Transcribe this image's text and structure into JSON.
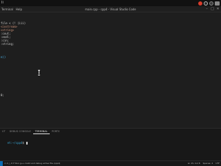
{
  "os_bar": {
    "left_label": "Ii"
  },
  "titlebar": {
    "menu": [
      "Terminal",
      "Help"
    ],
    "title": "main.cpp - cpp4 - Visual Studio Code",
    "controls": [
      "–",
      "□",
      "✕"
    ]
  },
  "editor": {
    "lines": [
      {
        "text": "file < (! (iii)",
        "color": "#d4d4d4"
      },
      {
        "text": "<iostream>",
        "color": "#ce9178"
      },
      {
        "text": "<string>",
        "color": "#ce9178"
      },
      {
        "text": ":cout;",
        "color": "#d4d4d4"
      },
      {
        "text": ":endl;",
        "color": "#d4d4d4"
      },
      {
        "text": ":cin;",
        "color": "#d4d4d4"
      },
      {
        "text": ":string;",
        "color": "#d4d4d4"
      },
      {
        "text": "n()",
        "color": "#4fc1ff"
      },
      {
        "text": "",
        "color": "#d4d4d4"
      },
      {
        "text": "0;",
        "color": "#d4d4d4"
      }
    ]
  },
  "panel": {
    "tabs": [
      {
        "label": "UT",
        "active": false
      },
      {
        "label": "DEBUG CONSOLE",
        "active": false
      },
      {
        "label": "TERMINAL",
        "active": true
      },
      {
        "label": "PORTS",
        "active": false
      }
    ],
    "terminal": {
      "path": "et:~/cpp4",
      "prompt": "$"
    }
  },
  "statusbar": {
    "left": "⚠ 0 △ 0  ⟳ Run g++ build and debug active file (cpp4)",
    "right": [
      "Ln 15, Col 8",
      "Spaces: 4",
      "UTF"
    ]
  }
}
